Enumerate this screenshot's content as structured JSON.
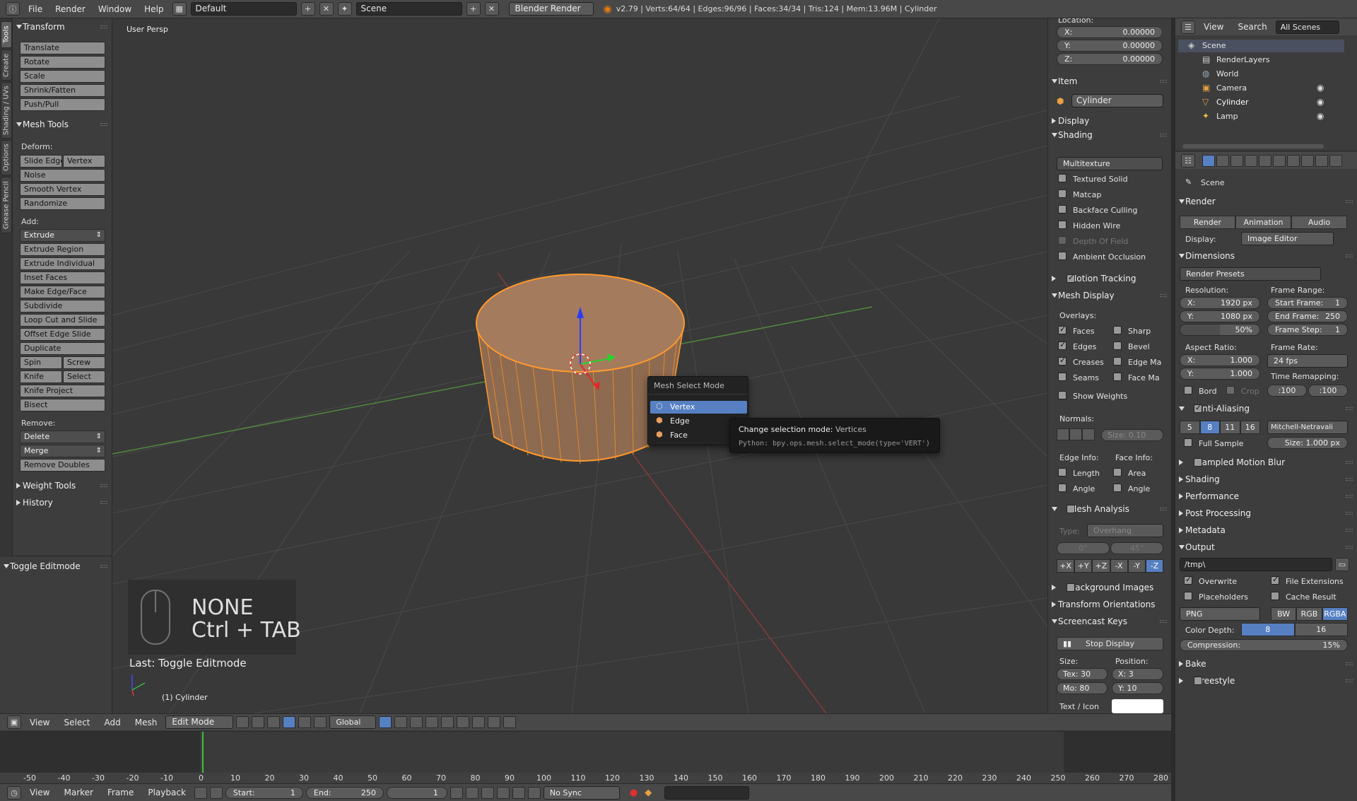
{
  "topbar": {
    "menus": [
      "File",
      "Render",
      "Window",
      "Help"
    ],
    "layout": "Default",
    "scene": "Scene",
    "engine": "Blender Render",
    "stats": "v2.79 | Verts:64/64 | Edges:96/96 | Faces:34/34 | Tris:124 | Mem:13.96M | Cylinder"
  },
  "left_tabs": [
    "Tools",
    "Create",
    "Shading / UVs",
    "Options",
    "Grease Pencil"
  ],
  "toolshelf": {
    "transform": {
      "title": "Transform",
      "buttons": [
        "Translate",
        "Rotate",
        "Scale",
        "Shrink/Fatten",
        "Push/Pull"
      ]
    },
    "mesh_tools": {
      "title": "Mesh Tools",
      "deform_label": "Deform:",
      "slide_edge": "Slide Edge",
      "vertex": "Vertex",
      "noise": "Noise",
      "smooth_vertex": "Smooth Vertex",
      "randomize": "Randomize",
      "add_label": "Add:",
      "extrude": "Extrude",
      "extrude_region": "Extrude Region",
      "extrude_individual": "Extrude Individual",
      "inset_faces": "Inset Faces",
      "make_edge_face": "Make Edge/Face",
      "subdivide": "Subdivide",
      "loop_cut": "Loop Cut and Slide",
      "offset_edge": "Offset Edge Slide",
      "duplicate": "Duplicate",
      "spin": "Spin",
      "screw": "Screw",
      "knife": "Knife",
      "select": "Select",
      "knife_project": "Knife Project",
      "bisect": "Bisect",
      "remove_label": "Remove:",
      "delete": "Delete",
      "merge": "Merge",
      "remove_doubles": "Remove Doubles"
    },
    "weight_tools": "Weight Tools",
    "history": "History",
    "toggle_editmode": "Toggle Editmode"
  },
  "viewport": {
    "view_label": "User Persp",
    "object_label": "(1) Cylinder",
    "screencast_key": "NONE",
    "screencast_combo": "Ctrl + TAB",
    "last_op": "Last: Toggle Editmode"
  },
  "popup": {
    "title": "Mesh Select Mode",
    "items": [
      "Vertex",
      "Edge",
      "Face"
    ],
    "tooltip_title": "Change selection mode:",
    "tooltip_value": "Vertices",
    "tooltip_python": "Python: bpy.ops.mesh.select_mode(type='VERT')"
  },
  "vpheader": {
    "menus": [
      "View",
      "Select",
      "Add",
      "Mesh"
    ],
    "mode": "Edit Mode",
    "orientation": "Global"
  },
  "timeline": {
    "ticks": [
      "-50",
      "-40",
      "-30",
      "-20",
      "-10",
      "0",
      "10",
      "20",
      "30",
      "40",
      "50",
      "60",
      "70",
      "80",
      "90",
      "100",
      "110",
      "120",
      "130",
      "140",
      "150",
      "160",
      "170",
      "180",
      "190",
      "200",
      "210",
      "220",
      "230",
      "240",
      "250",
      "260",
      "270",
      "280"
    ],
    "menus": [
      "View",
      "Marker",
      "Frame",
      "Playback"
    ],
    "start_label": "Start:",
    "start": "1",
    "end_label": "End:",
    "end": "250",
    "current": "1",
    "sync": "No Sync"
  },
  "npanel": {
    "location_label": "Location:",
    "loc": [
      {
        "axis": "X:",
        "value": "0.00000"
      },
      {
        "axis": "Y:",
        "value": "0.00000"
      },
      {
        "axis": "Z:",
        "value": "0.00000"
      }
    ],
    "item": "Item",
    "item_name": "Cylinder",
    "display": "Display",
    "shading": "Shading",
    "shading_mode": "Multitexture",
    "shading_checks": [
      "Textured Solid",
      "Matcap",
      "Backface Culling",
      "Hidden Wire",
      "Depth Of Field",
      "Ambient Occlusion"
    ],
    "motion_tracking": "Motion Tracking",
    "mesh_display": "Mesh Display",
    "overlays": "Overlays:",
    "ov_left": [
      "Faces",
      "Edges",
      "Creases",
      "Seams"
    ],
    "ov_right": [
      "Sharp",
      "Bevel",
      "Edge Ma",
      "Face Ma"
    ],
    "show_weights": "Show Weights",
    "normals": "Normals:",
    "normal_size": "Size:  0.10",
    "edge_info": "Edge Info:",
    "face_info": "Face Info:",
    "length": "Length",
    "area": "Area",
    "angle": "Angle",
    "mesh_analysis": "Mesh Analysis",
    "type_label": "Type:",
    "type_value": "Overhang",
    "range_a": "0°",
    "range_b": "45°",
    "axes": [
      "+X",
      "+Y",
      "+Z",
      "-X",
      "-Y",
      "-Z"
    ],
    "background_images": "Background Images",
    "transform_orientations": "Transform Orientations",
    "screencast_keys": "Screencast Keys",
    "stop_display": "Stop Display",
    "size_label": "Size:",
    "position_label": "Position:",
    "tex": "Tex: 30",
    "mo": "Mo: 80",
    "px": "X:    3",
    "py": "Y:   10",
    "text_icon": "Text / Icon"
  },
  "outliner": {
    "menus": [
      "View",
      "Search"
    ],
    "filter": "All Scenes",
    "tree": [
      "Scene",
      "RenderLayers",
      "World",
      "Camera",
      "Cylinder",
      "Lamp"
    ]
  },
  "props": {
    "scene": "Scene",
    "render": "Render",
    "render_btns": [
      "Render",
      "Animation",
      "Audio"
    ],
    "display_label": "Display:",
    "display_value": "Image Editor",
    "dimensions": "Dimensions",
    "render_presets": "Render Presets",
    "resolution": "Resolution:",
    "res_x": "1920 px",
    "res_y": "1080 px",
    "res_pct": "50%",
    "frame_range": "Frame Range:",
    "start_frame": "Start Frame:",
    "start_frame_v": "1",
    "end_frame": "End Frame:",
    "end_frame_v": "250",
    "frame_step": "Frame Step:",
    "frame_step_v": "1",
    "aspect": "Aspect Ratio:",
    "asp_x": "1.000",
    "asp_y": "1.000",
    "frame_rate": "Frame Rate:",
    "fps": "24 fps",
    "time_remap": "Time Remapping:",
    "remap_a": ":100",
    "remap_b": ":100",
    "bord": "Bord",
    "crop": "Crop",
    "anti_aliasing": "Anti-Aliasing",
    "aa_samples": [
      "5",
      "8",
      "11",
      "16"
    ],
    "filter": "Mitchell-Netravali",
    "full_sample": "Full Sample",
    "aa_size": "Size:   1.000 px",
    "sections": [
      "Sampled Motion Blur",
      "Shading",
      "Performance",
      "Post Processing",
      "Metadata"
    ],
    "output": "Output",
    "path": "/tmp\\",
    "overwrite": "Overwrite",
    "file_extensions": "File Extensions",
    "placeholders": "Placeholders",
    "cache_result": "Cache Result",
    "format": "PNG",
    "color_modes": [
      "BW",
      "RGB",
      "RGBA"
    ],
    "color_depth": "Color Depth:",
    "depth_a": "8",
    "depth_b": "16",
    "compression": "Compression:",
    "compression_v": "15%",
    "bake": "Bake",
    "freestyle": "Freestyle"
  },
  "colors": {
    "accent": "#5680c2",
    "selection_orange": "#ff9a2e",
    "panel": "#3d3d3d"
  }
}
